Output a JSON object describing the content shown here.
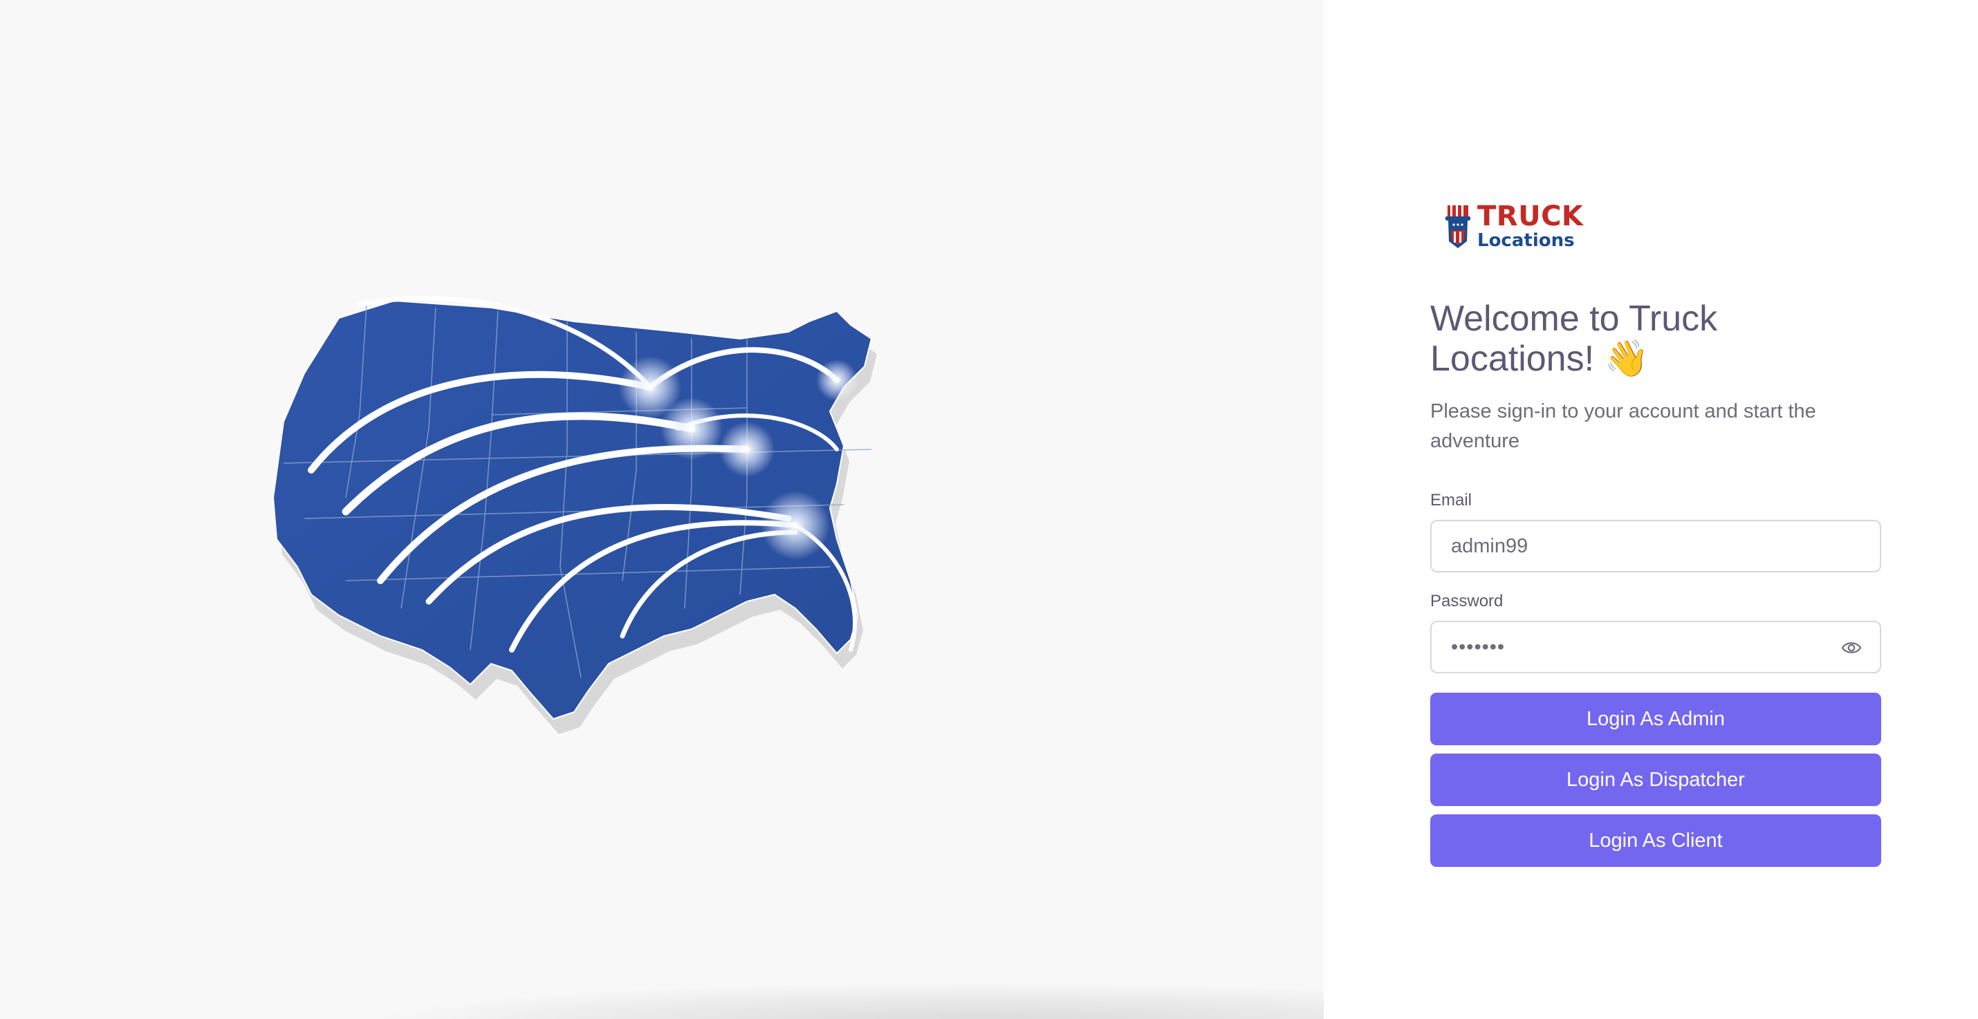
{
  "brand": {
    "name_line1": "TRUCK",
    "name_line2": "Locations"
  },
  "login": {
    "welcome_title": "Welcome to Truck Locations! 👋",
    "subtitle": "Please sign-in to your account and start the adventure",
    "email_label": "Email",
    "email_value": "admin99",
    "password_label": "Password",
    "password_value": "•••••••",
    "buttons": {
      "admin": "Login As Admin",
      "dispatcher": "Login As Dispatcher",
      "client": "Login As Client"
    }
  },
  "icons": {
    "logo": "uncle-sam-hat-logo-icon",
    "password_toggle": "eye-icon"
  },
  "colors": {
    "primary": "#7367f0",
    "heading": "#5e5873",
    "body_text": "#6e6b7b",
    "input_border": "#d8d6de",
    "left_background": "#f8f8f8",
    "map_blue": "#2d52a3",
    "brand_red": "#c32a25",
    "brand_blue": "#1d4b8f"
  }
}
